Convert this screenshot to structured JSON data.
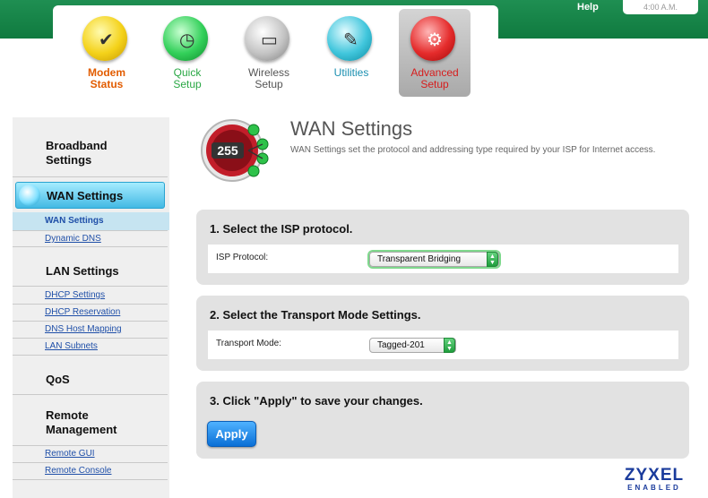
{
  "header": {
    "help": "Help",
    "time": "4:00 A.M."
  },
  "tabs": [
    {
      "label": "Modem\nStatus",
      "color": "#e25c00",
      "active": false
    },
    {
      "label": "Quick\nSetup",
      "color": "#2aa845",
      "active": false
    },
    {
      "label": "Wireless\nSetup",
      "color": "#555555",
      "active": false
    },
    {
      "label": "Utilities",
      "color": "#1a8fb0",
      "active": false
    },
    {
      "label": "Advanced\nSetup",
      "color": "#d61d1d",
      "active": true
    }
  ],
  "sidebar": {
    "broadband": "Broadband\nSettings",
    "selected": "WAN Settings",
    "wan_links": [
      "WAN Settings",
      "Dynamic DNS"
    ],
    "lan": "LAN Settings",
    "lan_links": [
      "DHCP Settings",
      "DHCP Reservation",
      "DNS Host Mapping",
      "LAN Subnets"
    ],
    "qos": "QoS",
    "remote": "Remote\nManagement",
    "remote_links": [
      "Remote GUI",
      "Remote Console"
    ]
  },
  "page": {
    "icon_text": "255",
    "title": "WAN Settings",
    "description": "WAN Settings set the protocol and addressing type required by your ISP for Internet access."
  },
  "sections": {
    "isp": {
      "heading": "1. Select the ISP protocol.",
      "label": "ISP Protocol:",
      "value": "Transparent Bridging"
    },
    "transport": {
      "heading": "2. Select the Transport Mode Settings.",
      "label": "Transport Mode:",
      "value": "Tagged-201"
    },
    "apply": {
      "heading": "3. Click \"Apply\" to save your changes.",
      "button": "Apply"
    }
  },
  "logo": {
    "brand": "ZYXEL",
    "tag": "ENABLED"
  },
  "colors": {
    "accent_green": "#0f7a3f",
    "link_blue": "#1f4fa8",
    "apply_blue": "#0a6fd6"
  }
}
